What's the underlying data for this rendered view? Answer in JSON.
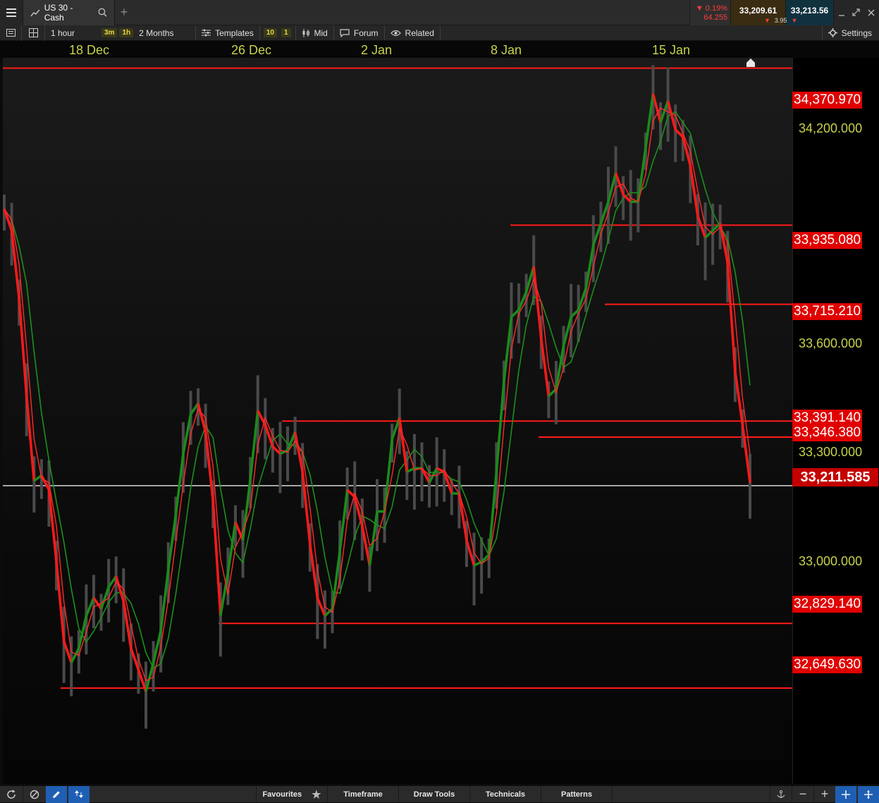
{
  "window": {
    "instrument": "US 30 - Cash",
    "change_pct": "0.19%",
    "change_pts": "64.255",
    "bid": "33,209.61",
    "ask": "33,213.56",
    "spread": "3.95"
  },
  "toolbar": {
    "interval": "1 hour",
    "quick_3m": "3m",
    "quick_1h": "1h",
    "range": "2 Months",
    "templates": "Templates",
    "badge_10": "10",
    "badge_1": "1",
    "mid": "Mid",
    "forum": "Forum",
    "related": "Related",
    "settings": "Settings"
  },
  "dates": [
    "18 Dec",
    "26 Dec",
    "2 Jan",
    "8 Jan",
    "15 Jan"
  ],
  "axis_ticks": [
    "34,200.000",
    "33,600.000",
    "33,300.000",
    "33,000.000"
  ],
  "levels": [
    "34,370.970",
    "33,935.080",
    "33,715.210",
    "33,391.140",
    "33,346.380",
    "32,829.140",
    "32,649.630"
  ],
  "current_price": "33,211.585",
  "bottom": {
    "favourites": "Favourites",
    "timeframe": "Timeframe",
    "draw_tools": "Draw Tools",
    "technicals": "Technicals",
    "patterns": "Patterns"
  },
  "colors": {
    "level": "#ff1a1a",
    "up": "#1a8c1a",
    "down": "#ff1a1a",
    "axis_text": "#c8d24a",
    "current": "#d00000"
  },
  "chart_data": {
    "type": "line",
    "ylim": [
      32450,
      34600
    ],
    "x_labels": [
      "18 Dec",
      "26 Dec",
      "2 Jan",
      "8 Jan",
      "15 Jan"
    ],
    "y_ticks": [
      34200,
      33600,
      33300,
      33000
    ],
    "horizontal_levels": [
      34370.97,
      33935.08,
      33715.21,
      33391.14,
      33346.38,
      32829.14,
      32649.63
    ],
    "current_price": 33211.585,
    "series": [
      {
        "values": [
          33980,
          33920,
          33730,
          33460,
          33225,
          33240,
          33200,
          33000,
          32780,
          32720,
          32760,
          32850,
          32900,
          32870,
          32930,
          32960,
          32890,
          32760,
          32700,
          32640,
          32720,
          32810,
          32980,
          33130,
          33300,
          33410,
          33440,
          33360,
          33170,
          32850,
          32970,
          33110,
          33060,
          33230,
          33420,
          33380,
          33320,
          33300,
          33310,
          33360,
          33250,
          33050,
          32900,
          32850,
          32870,
          33030,
          33200,
          33180,
          33100,
          32990,
          33140,
          33140,
          33340,
          33400,
          33250,
          33260,
          33260,
          33220,
          33260,
          33250,
          33190,
          33190,
          33060,
          32990,
          33000,
          33020,
          33250,
          33500,
          33680,
          33700,
          33750,
          33820,
          33620,
          33460,
          33480,
          33600,
          33680,
          33700,
          33760,
          33880,
          33940,
          34000,
          34080,
          34020,
          34000,
          34000,
          34150,
          34300,
          34220,
          34280,
          34200,
          34180,
          34100,
          33960,
          33900,
          33920,
          33940,
          33830,
          33530,
          33380,
          33220
        ]
      }
    ]
  }
}
